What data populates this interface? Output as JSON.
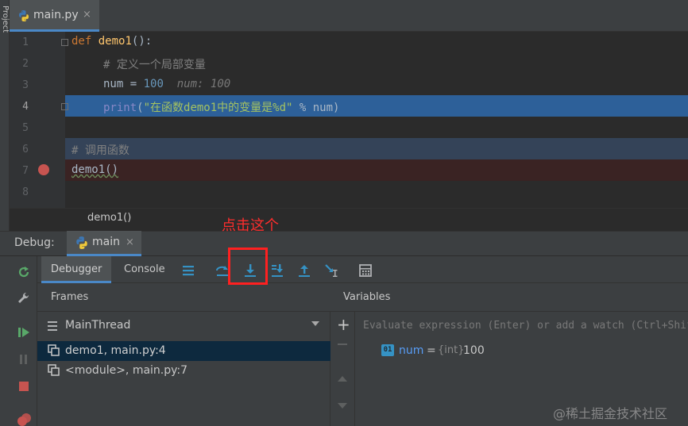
{
  "project_strip": {
    "label": "Project"
  },
  "file_tab": {
    "label": "main.py",
    "close": "×"
  },
  "editor": {
    "line_numbers": [
      "1",
      "2",
      "3",
      "4",
      "5",
      "6",
      "7",
      "8"
    ],
    "line1": {
      "kw": "def",
      "name": "demo1",
      "rest": "():"
    },
    "line2": {
      "comment": "# 定义一个局部变量"
    },
    "line3": {
      "var": "num",
      "op": " = ",
      "value": "100",
      "hint": "num: 100"
    },
    "line4": {
      "func": "print",
      "open": "(",
      "string": "\"在函数demo1中的变量是%d\"",
      "rest": " % num)"
    },
    "line6": {
      "comment": "# 调用函数"
    },
    "line7": {
      "call": "demo1()"
    }
  },
  "breadcrumb": {
    "text": "demo1()"
  },
  "annotation": {
    "text": "点击这个"
  },
  "debug": {
    "label": "Debug:",
    "session_tab": "main",
    "session_close": "×",
    "tabs": {
      "debugger": "Debugger",
      "console": "Console"
    },
    "frames": {
      "header": "Frames",
      "thread": "MainThread",
      "items": [
        {
          "label": "demo1, main.py:4"
        },
        {
          "label": "<module>, main.py:7"
        }
      ]
    },
    "variables": {
      "header": "Variables",
      "eval_placeholder": "Evaluate expression (Enter) or add a watch (Ctrl+Shift+Enter)",
      "items": [
        {
          "badge": "01",
          "name": "num",
          "eq": "=",
          "type": "{int}",
          "value": "100"
        }
      ]
    }
  },
  "watermark": {
    "text": "@稀土掘金技术社区"
  },
  "colors": {
    "accent": "#4a88c7",
    "current_line": "#2d6099",
    "breakpoint": "#c75450",
    "annotation": "#ff2d2d"
  }
}
